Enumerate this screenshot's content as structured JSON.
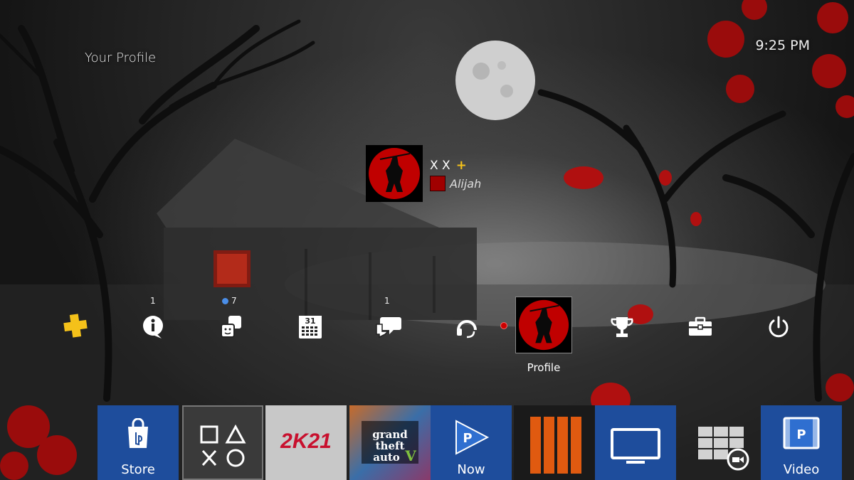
{
  "header": {
    "title": "Your Profile",
    "clock": "9:25 PM"
  },
  "profile_card": {
    "name": "X X",
    "plus_symbol": "+",
    "online_id": "Alijah"
  },
  "function_area": {
    "items": [
      {
        "name": "playstation-plus",
        "icon": "ps-plus-icon",
        "badge": ""
      },
      {
        "name": "notifications",
        "icon": "info-bubble-icon",
        "badge": "1"
      },
      {
        "name": "friends",
        "icon": "friends-icon",
        "badge": "7"
      },
      {
        "name": "events",
        "icon": "calendar-icon",
        "badge": "",
        "calendar_day": "31"
      },
      {
        "name": "messages",
        "icon": "messages-icon",
        "badge": "1"
      },
      {
        "name": "party",
        "icon": "headset-icon",
        "badge": ""
      },
      {
        "name": "profile",
        "icon": "profile-avatar",
        "badge": ""
      },
      {
        "name": "trophies",
        "icon": "trophy-icon",
        "badge": ""
      },
      {
        "name": "settings",
        "icon": "toolbox-icon",
        "badge": ""
      },
      {
        "name": "power",
        "icon": "power-icon",
        "badge": ""
      }
    ],
    "profile_label": "Profile"
  },
  "shelf": {
    "tiles": [
      {
        "name": "store",
        "label": "Store",
        "icon": "ps-store-icon"
      },
      {
        "name": "playroom",
        "label": "",
        "icon": "ps-shapes-icon"
      },
      {
        "name": "nba-2k21",
        "label": "2K21",
        "icon": "nba2k21-logo"
      },
      {
        "name": "gta-v",
        "label": "",
        "icon": "gta-v-logo"
      },
      {
        "name": "ps-now",
        "label": "Now",
        "icon": "ps-now-icon"
      },
      {
        "name": "black-ops-4",
        "label": "",
        "icon": "black-ops-iiii-logo"
      },
      {
        "name": "tv",
        "label": "",
        "icon": "tv-icon"
      },
      {
        "name": "library",
        "label": "",
        "icon": "library-icon"
      },
      {
        "name": "video",
        "label": "Video",
        "icon": "video-icon"
      }
    ]
  },
  "colors": {
    "plus_gold": "#f4c11a",
    "ps_blue": "#1f4fa0",
    "blood_red": "#b00000"
  }
}
